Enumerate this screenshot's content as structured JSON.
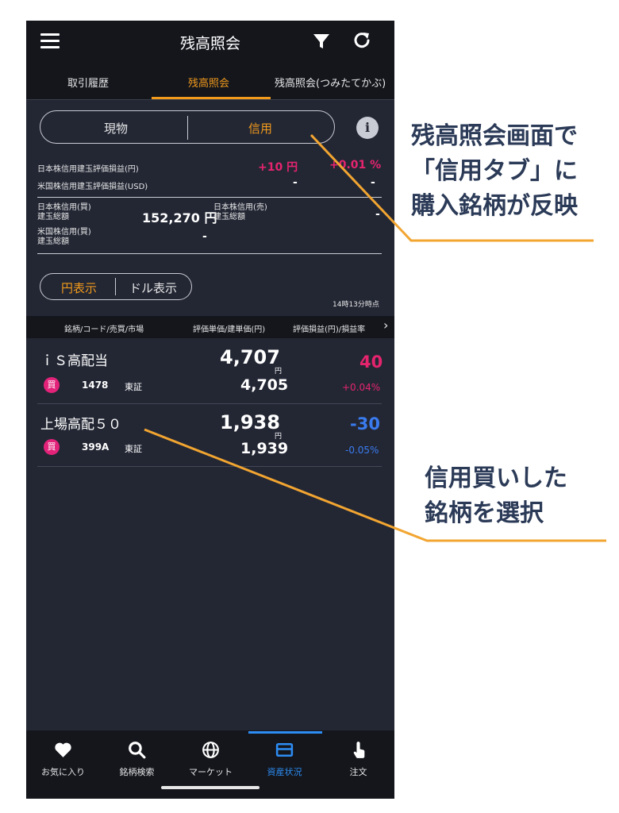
{
  "header": {
    "title": "残高照会"
  },
  "tabs": [
    {
      "label": "取引履歴"
    },
    {
      "label": "残高照会"
    },
    {
      "label": "残高照会(つみたてかぶ)"
    }
  ],
  "segment": {
    "left": "現物",
    "right": "信用"
  },
  "summary": {
    "jp_label": "日本株信用建玉評価損益(円)",
    "jp_value": "+10 円",
    "jp_rate": "+0.01 %",
    "us_label": "米国株信用建玉評価損益(USD)",
    "us_value": "-",
    "us_rate": "-",
    "jp_buy_label_1": "日本株信用(買)",
    "jp_buy_label_2": "建玉総額",
    "jp_buy_value": "152,270 円",
    "jp_sell_label_1": "日本株信用(売)",
    "jp_sell_label_2": "建玉総額",
    "jp_sell_value": "-",
    "us_buy_label_1": "米国株信用(買)",
    "us_buy_label_2": "建玉総額",
    "us_buy_value": "-"
  },
  "currency": {
    "yen": "円表示",
    "dollar": "ドル表示",
    "timestamp": "14時13分時点"
  },
  "table_header": {
    "col1": "銘柄/コード/売買/市場",
    "col2": "評価単価/建単価(円)",
    "col3": "評価損益(円)/損益率",
    "more": "›"
  },
  "rows": [
    {
      "name": "ｉＳ高配当",
      "badge": "買",
      "code": "1478",
      "market": "東証",
      "eval_price": "4,707",
      "yen": "円",
      "cost_price": "4,705",
      "pl": "40",
      "rate": "+0.04%",
      "pl_color": "#e6246e"
    },
    {
      "name": "上場高配５０",
      "badge": "買",
      "code": "399A",
      "market": "東証",
      "eval_price": "1,938",
      "yen": "円",
      "cost_price": "1,939",
      "pl": "-30",
      "rate": "-0.05%",
      "pl_color": "#3a7bef"
    }
  ],
  "nav": [
    {
      "label": "お気に入り",
      "icon": "heart-icon"
    },
    {
      "label": "銘柄検索",
      "icon": "search-icon"
    },
    {
      "label": "マーケット",
      "icon": "globe-icon"
    },
    {
      "label": "資産状況",
      "icon": "card-icon"
    },
    {
      "label": "注文",
      "icon": "tap-icon"
    }
  ],
  "annotations": {
    "a1_line1": "残高照会画面で",
    "a1_line2": "「信用タブ」に",
    "a1_line3": "購入銘柄が反映",
    "a2_line1": "信用買いした",
    "a2_line2": "銘柄を選択"
  },
  "colors": {
    "accent": "#f19a1c",
    "positive": "#e6246e",
    "negative": "#3a7bef",
    "nav_active": "#2d8df4",
    "annotation": "#2b3a57"
  }
}
